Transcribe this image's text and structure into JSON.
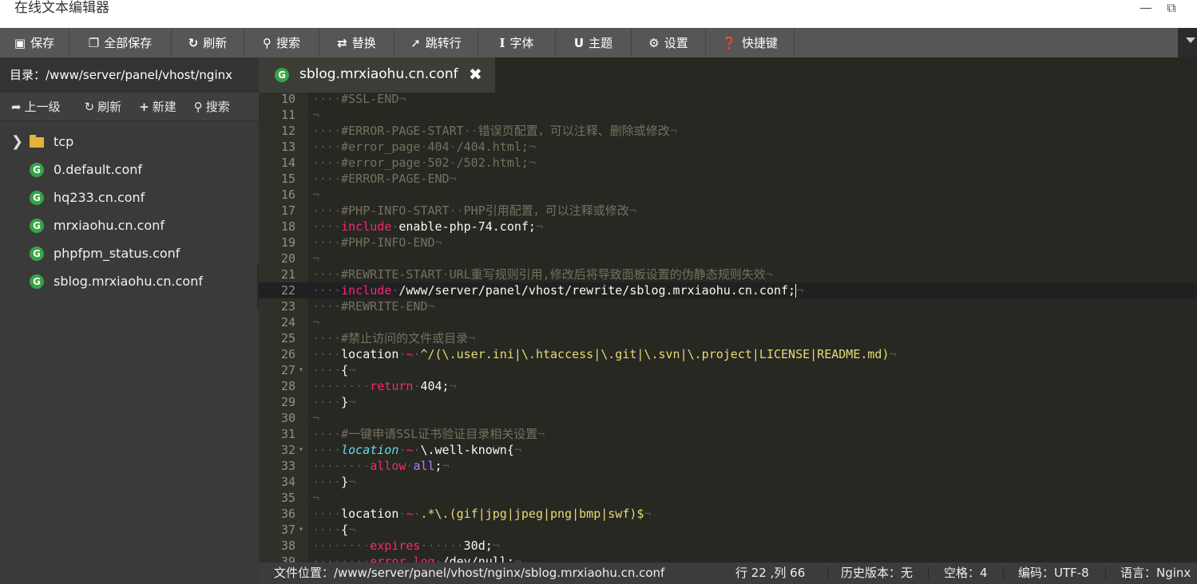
{
  "window": {
    "title": "在线文本编辑器",
    "minimize_icon": "minimize-icon",
    "maximize_icon": "maximize-icon"
  },
  "toolbar": {
    "items": [
      {
        "label": "保存",
        "icon": "save-icon"
      },
      {
        "label": "全部保存",
        "icon": "save-all-icon"
      },
      {
        "label": "刷新",
        "icon": "refresh-icon"
      },
      {
        "label": "搜索",
        "icon": "search-icon"
      },
      {
        "label": "替换",
        "icon": "replace-icon"
      },
      {
        "label": "跳转行",
        "icon": "goto-line-icon"
      },
      {
        "label": "字体",
        "icon": "font-icon"
      },
      {
        "label": "主题",
        "icon": "theme-icon"
      },
      {
        "label": "设置",
        "icon": "settings-icon"
      },
      {
        "label": "快捷键",
        "icon": "help-icon"
      }
    ]
  },
  "sidebar": {
    "path_label": "目录：/www/server/panel/vhost/nginx",
    "actions": [
      {
        "label": "上一级",
        "icon": "up-arrow-icon"
      },
      {
        "label": "刷新",
        "icon": "refresh-icon"
      },
      {
        "label": "新建",
        "icon": "plus-icon"
      },
      {
        "label": "搜索",
        "icon": "search-icon"
      }
    ],
    "items": [
      {
        "label": "tcp",
        "type": "folder"
      },
      {
        "label": "0.default.conf",
        "type": "file"
      },
      {
        "label": "hq233.cn.conf",
        "type": "file"
      },
      {
        "label": "mrxiaohu.cn.conf",
        "type": "file"
      },
      {
        "label": "phpfpm_status.conf",
        "type": "file"
      },
      {
        "label": "sblog.mrxiaohu.cn.conf",
        "type": "file"
      }
    ]
  },
  "tab": {
    "label": "sblog.mrxiaohu.cn.conf",
    "close_icon": "close-icon"
  },
  "editor": {
    "active_line": 22,
    "lines": [
      {
        "n": "10",
        "text": "····#SSL-END¬"
      },
      {
        "n": "11",
        "text": "¬"
      },
      {
        "n": "12",
        "text": "····#ERROR-PAGE-START··错误页配置，可以注释、删除或修改¬"
      },
      {
        "n": "13",
        "text": "····#error_page·404·/404.html;¬"
      },
      {
        "n": "14",
        "text": "····#error_page·502·/502.html;¬"
      },
      {
        "n": "15",
        "text": "····#ERROR-PAGE-END¬"
      },
      {
        "n": "16",
        "text": "¬"
      },
      {
        "n": "17",
        "text": "····#PHP-INFO-START··PHP引用配置，可以注释或修改¬"
      },
      {
        "n": "18",
        "text": "····include·enable-php-74.conf;¬"
      },
      {
        "n": "19",
        "text": "····#PHP-INFO-END¬"
      },
      {
        "n": "20",
        "text": "¬"
      },
      {
        "n": "21",
        "text": "····#REWRITE-START·URL重写规则引用,修改后将导致面板设置的伪静态规则失效¬"
      },
      {
        "n": "22",
        "text": "····include·/www/server/panel/vhost/rewrite/sblog.mrxiaohu.cn.conf;¬"
      },
      {
        "n": "23",
        "text": "····#REWRITE-END¬"
      },
      {
        "n": "24",
        "text": "¬"
      },
      {
        "n": "25",
        "text": "····#禁止访问的文件或目录¬"
      },
      {
        "n": "26",
        "text": "····location·~·^/(\\.user.ini|\\.htaccess|\\.git|\\.svn|\\.project|LICENSE|README.md)¬"
      },
      {
        "n": "27",
        "text": "····{¬"
      },
      {
        "n": "28",
        "text": "········return·404;¬"
      },
      {
        "n": "29",
        "text": "····}¬"
      },
      {
        "n": "30",
        "text": "¬"
      },
      {
        "n": "31",
        "text": "····#一键申请SSL证书验证目录相关设置¬"
      },
      {
        "n": "32",
        "text": "····location·~·\\.well-known{¬"
      },
      {
        "n": "33",
        "text": "········allow·all;¬"
      },
      {
        "n": "34",
        "text": "····}¬"
      },
      {
        "n": "35",
        "text": "¬"
      },
      {
        "n": "36",
        "text": "····location·~·.*\\.(gif|jpg|jpeg|png|bmp|swf)$¬"
      },
      {
        "n": "37",
        "text": "····{¬"
      },
      {
        "n": "38",
        "text": "········expires······30d;¬"
      },
      {
        "n": "39",
        "text": "········error_log·/dev/null;¬"
      }
    ]
  },
  "statusbar": {
    "file_location": "文件位置：/www/server/panel/vhost/nginx/sblog.mrxiaohu.cn.conf",
    "cursor_pos": "行 22 ,列 66",
    "history": "历史版本：无",
    "indent": "空格：4",
    "encoding": "编码：UTF-8",
    "language": "语言：Nginx"
  },
  "colors": {
    "editor_bg": "#272822",
    "toolbar_bg": "#565656",
    "sidebar_bg": "#3a3a3a",
    "file_icon_green": "#37a346",
    "folder_yellow": "#e2b33a"
  }
}
